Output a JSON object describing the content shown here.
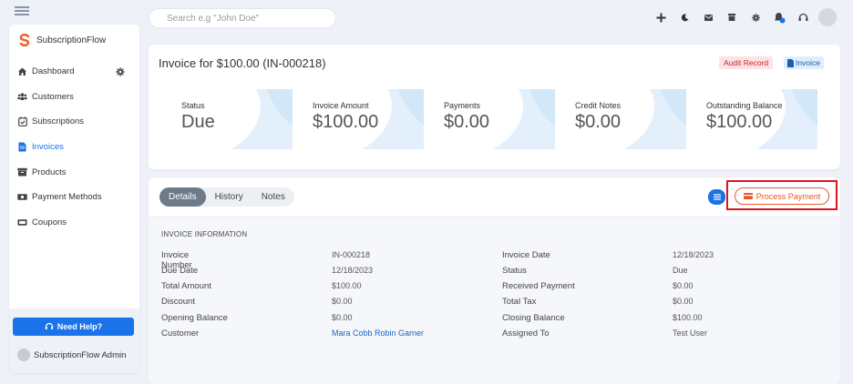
{
  "sidebar": {
    "brand": "SubscriptionFlow",
    "items": [
      {
        "label": "Dashboard"
      },
      {
        "label": "Customers"
      },
      {
        "label": "Subscriptions"
      },
      {
        "label": "Invoices"
      },
      {
        "label": "Products"
      },
      {
        "label": "Payment Methods"
      },
      {
        "label": "Coupons"
      }
    ],
    "help_label": "Need Help?",
    "user_name": "SubscriptionFlow Admin"
  },
  "search": {
    "placeholder": "Search e.g \"John Doe\""
  },
  "invoice": {
    "title": "Invoice for $100.00 (IN-000218)",
    "audit_label": "Audit Record",
    "invoice_label": "Invoice"
  },
  "stats": [
    {
      "label": "Status",
      "value": "Due"
    },
    {
      "label": "Invoice Amount",
      "value": "$100.00"
    },
    {
      "label": "Payments",
      "value": "$0.00"
    },
    {
      "label": "Credit Notes",
      "value": "$0.00"
    },
    {
      "label": "Outstanding Balance",
      "value": "$100.00"
    }
  ],
  "tabs": [
    {
      "label": "Details"
    },
    {
      "label": "History"
    },
    {
      "label": "Notes"
    }
  ],
  "process_payment_label": "Process Payment",
  "section_title": "INVOICE INFORMATION",
  "info_left": [
    {
      "label": "Invoice Number",
      "value": "IN-000218"
    },
    {
      "label": "Due Date",
      "value": "12/18/2023"
    },
    {
      "label": "Total Amount",
      "value": "$100.00"
    },
    {
      "label": "Discount",
      "value": "$0.00"
    },
    {
      "label": "Opening Balance",
      "value": "$0.00"
    },
    {
      "label": "Customer",
      "value": "Mara Cobb Robin Garner"
    }
  ],
  "info_right": [
    {
      "label": "Invoice Date",
      "value": "12/18/2023"
    },
    {
      "label": "Status",
      "value": "Due"
    },
    {
      "label": "Received Payment",
      "value": "$0.00"
    },
    {
      "label": "Total Tax",
      "value": "$0.00"
    },
    {
      "label": "Closing Balance",
      "value": "$100.00"
    },
    {
      "label": "Assigned To",
      "value": "Test User"
    }
  ],
  "colors": {
    "accent": "#1a73e8",
    "payment": "#e8562a",
    "highlight": "#e0121e"
  }
}
